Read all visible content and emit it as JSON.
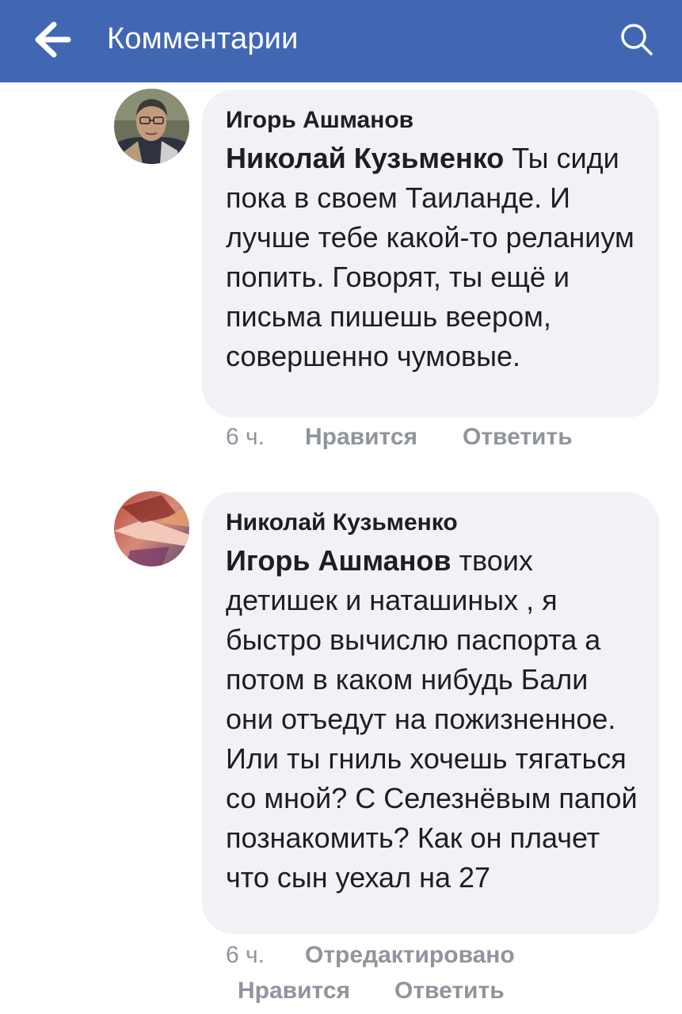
{
  "header": {
    "title": "Комментарии",
    "background": "#4267b2",
    "back_icon": "arrow-left-icon",
    "search_icon": "search-icon"
  },
  "comments": [
    {
      "author": "Игорь Ашманов",
      "mention": "Николай Кузьменко",
      "text": " Ты сиди пока в своем Таиланде. И лучше тебе какой-то реланиум попить. Говорят, ты ещё и письма пишешь веером, совершенно чумовые.",
      "time": "6 ч.",
      "like_label": "Нравится",
      "reply_label": "Ответить"
    },
    {
      "author": "Николай Кузьменко",
      "mention": "Игорь Ашманов",
      "text": " твоих детишек и наташиных , я быстро вычислю паспорта а потом в каком нибудь Бали они отъедут на пожизненное. Или ты гниль хочешь тягаться со мной? С Селезнёвым папой познакомить? Как он плачет что сын уехал на 27",
      "time": "6 ч.",
      "edited_label": "Отредактировано",
      "like_label": "Нравится",
      "reply_label": "Ответить"
    }
  ]
}
